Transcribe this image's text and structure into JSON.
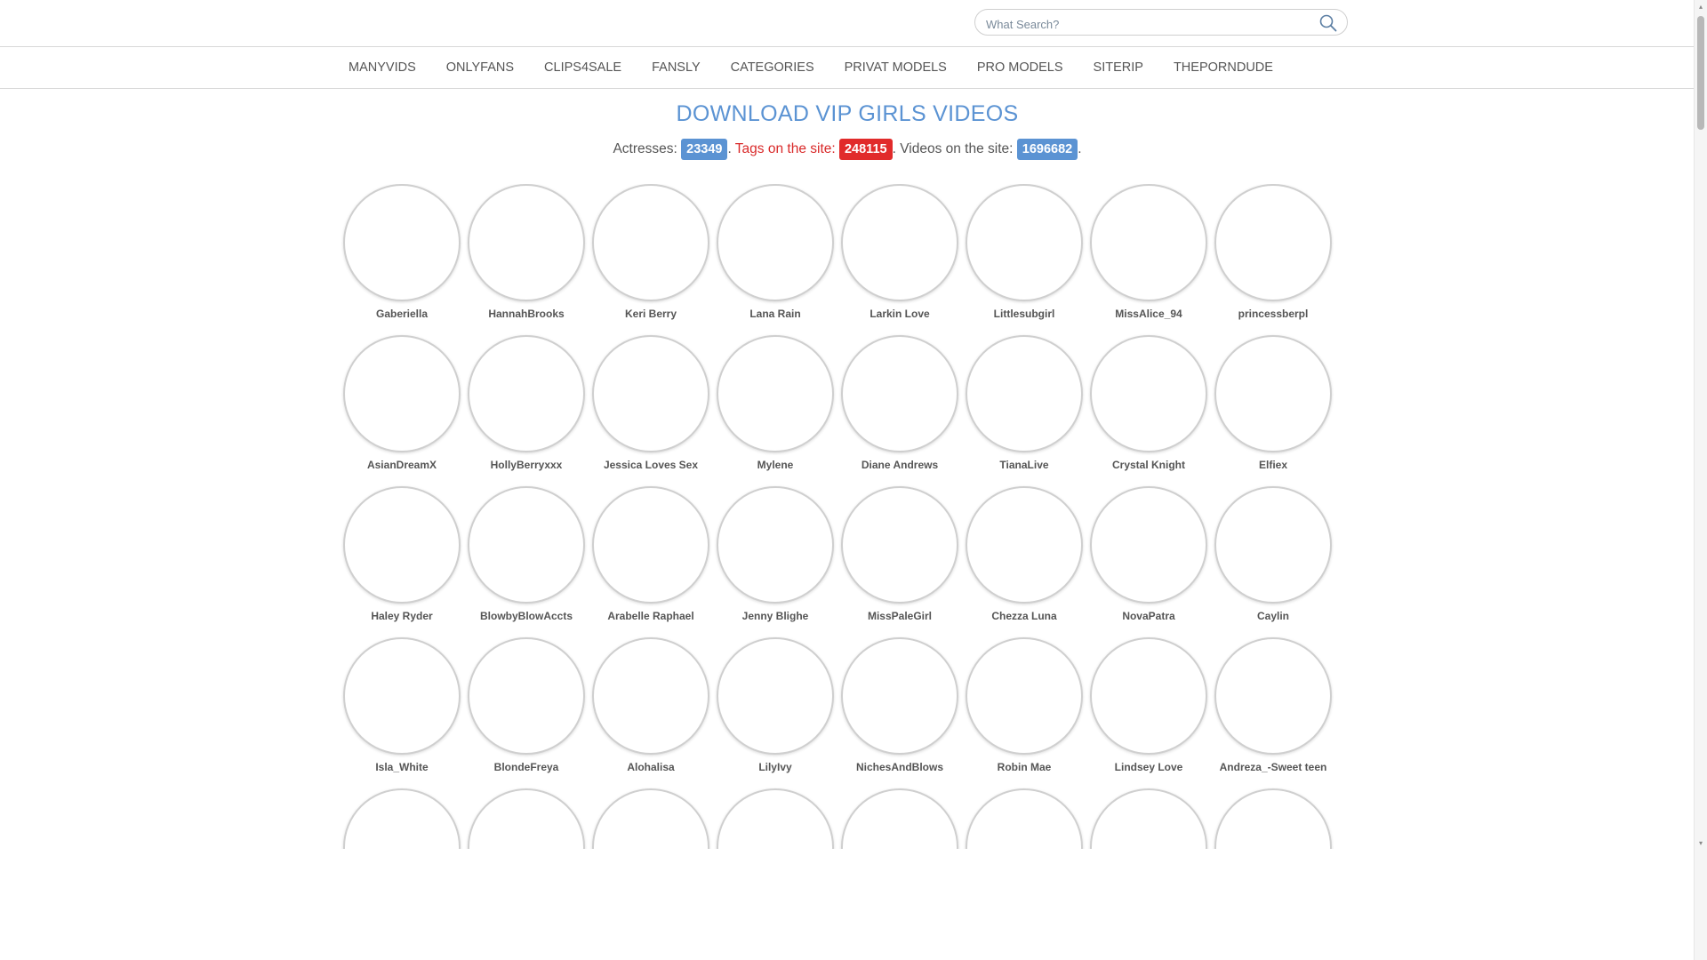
{
  "search": {
    "placeholder": "What Search?"
  },
  "nav": [
    "MANYVIDS",
    "ONLYFANS",
    "CLIPS4SALE",
    "FANSLY",
    "CATEGORIES",
    "PRIVAT MODELS",
    "PRO MODELS",
    "SITERIP",
    "THEPORNDUDE"
  ],
  "title": "DOWNLOAD VIP GIRLS VIDEOS",
  "stats": {
    "actresses_label": "Actresses:",
    "actresses_count": "23349",
    "sep1": ".",
    "tags_label": "Tags on the site:",
    "tags_count": "248115",
    "sep2": ".",
    "videos_label": "Videos on the site:",
    "videos_count": "1696682",
    "sep3": "."
  },
  "colors": {
    "accent_blue": "#5b93d3",
    "accent_red": "#e12b2b"
  },
  "models": [
    "Gaberiella",
    "HannahBrooks",
    "Keri Berry",
    "Lana Rain",
    "Larkin Love",
    "Littlesubgirl",
    "MissAlice_94",
    "princessberpl",
    "AsianDreamX",
    "HollyBerryxxx",
    "Jessica Loves Sex",
    "Mylene",
    "Diane Andrews",
    "TianaLive",
    "Crystal Knight",
    "Elfiex",
    "Haley Ryder",
    "BlowbyBlowAccts",
    "Arabelle Raphael",
    "Jenny Blighe",
    "MissPaleGirl",
    "Chezza Luna",
    "NovaPatra",
    "Caylin",
    "Isla_White",
    "BlondeFreya",
    "Alohalisa",
    "LilyIvy",
    "NichesAndBlows",
    "Robin Mae",
    "Lindsey Love",
    "Andreza_-Sweet teen",
    "",
    "",
    "",
    "",
    "",
    "",
    "",
    ""
  ]
}
